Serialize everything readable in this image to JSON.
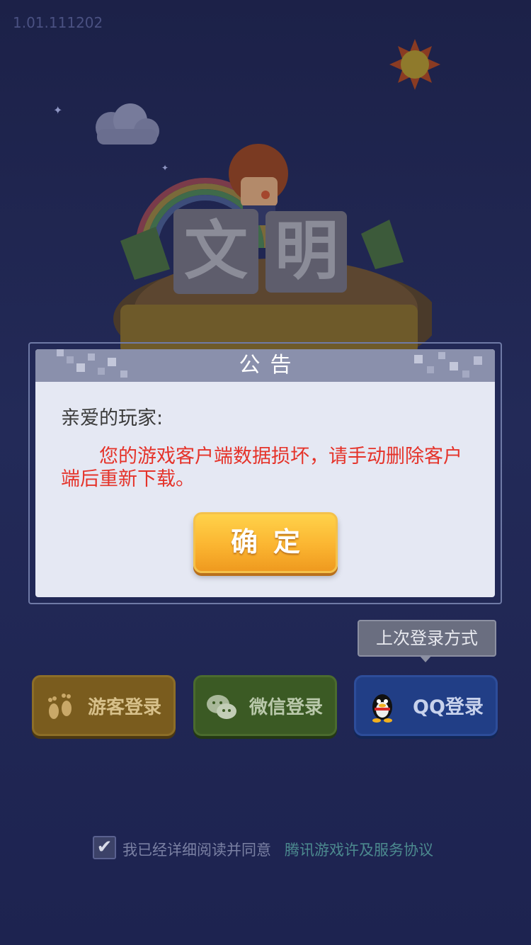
{
  "app": {
    "version": "1.01.111202"
  },
  "notice": {
    "title": "公告",
    "greeting": "亲爱的玩家:",
    "message": "您的游戏客户端数据损坏，请手动删除客户端后重新下载。",
    "confirm_label": "确定"
  },
  "login": {
    "last_login_hint": "上次登录方式",
    "buttons": [
      {
        "label": "游客登录",
        "icon": "footprint-icon"
      },
      {
        "label": "微信登录",
        "icon": "wechat-icon"
      },
      {
        "label": "QQ登录",
        "icon": "qq-penguin-icon"
      }
    ]
  },
  "agreement": {
    "checked": true,
    "text": "我已经详细阅读并同意",
    "link": "腾讯游戏许及服务协议"
  },
  "colors": {
    "background": "#1f2550",
    "notice_text": "#e5332a",
    "confirm_button": "#fbb531",
    "guest_button": "#7a5c1e",
    "wechat_button": "#3b5a24",
    "qq_button": "#213e86"
  }
}
